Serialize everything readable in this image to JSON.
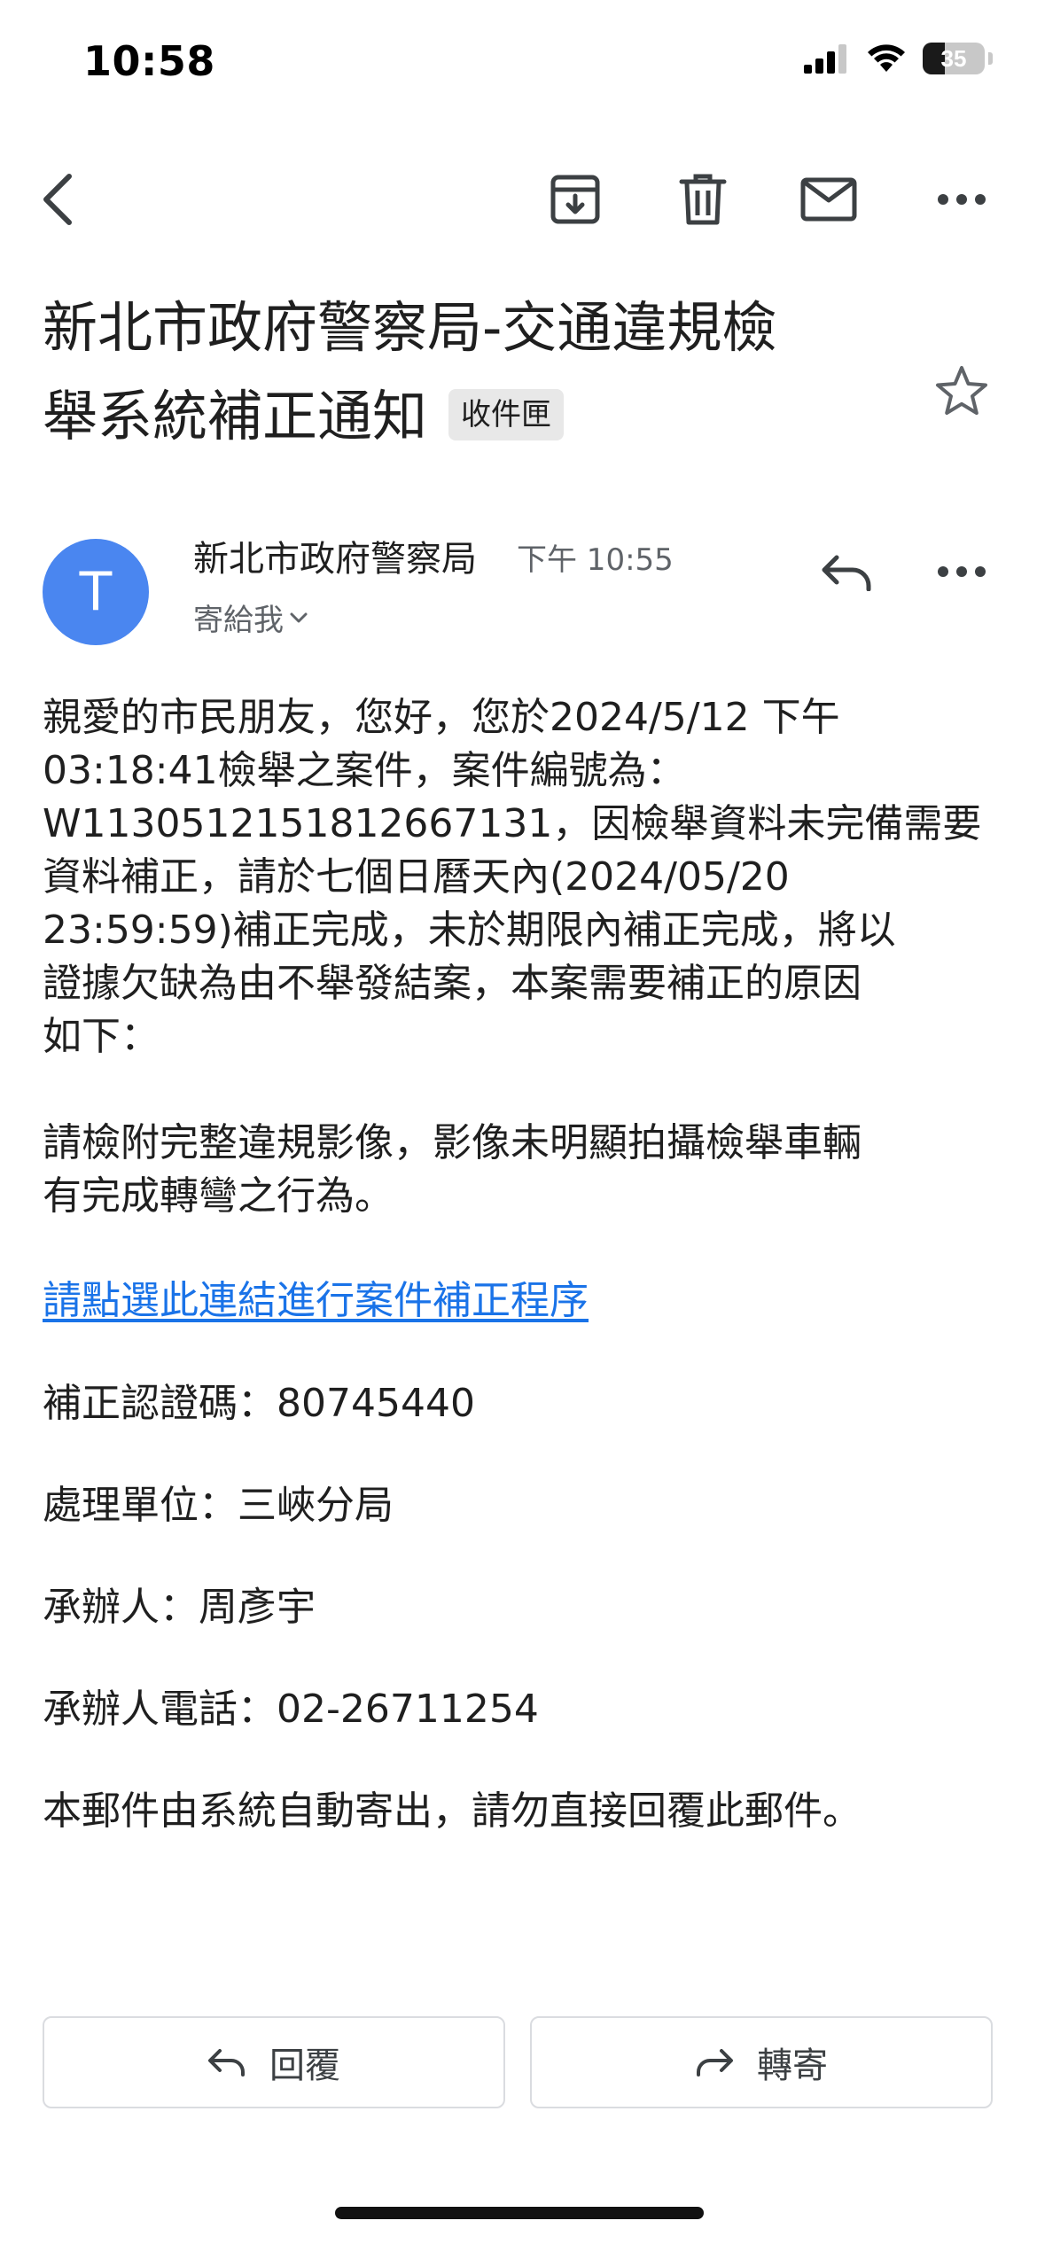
{
  "status_bar": {
    "time": "10:58",
    "battery": "35",
    "battery_level": 0.35
  },
  "toolbar": {
    "icons": [
      "back-arrow-icon",
      "archive-icon",
      "trash-icon",
      "mark-unread-icon",
      "more-icon"
    ]
  },
  "subject": {
    "line1": "新北市政府警察局-交通違規檢",
    "line2": "舉系統補正通知",
    "label": "收件匣"
  },
  "sender": {
    "avatar_letter": "T",
    "avatar_color": "#4a86f0",
    "name": "新北市政府警察局",
    "time": "下午 10:55",
    "recipient": "寄給我"
  },
  "body": {
    "intro_lines": [
      "親愛的市民朋友，您好，您於2024/5/12 下午",
      "03:18:41檢舉之案件，案件編號為：",
      "W1130512151812667131，因檢舉資料未完備需要",
      "資料補正，請於七個日曆天內(2024/05/20",
      "23:59:59)補正完成，未於期限內補正完成，將以",
      "證據欠缺為由不舉發結案，本案需要補正的原因",
      "如下："
    ],
    "reason_lines": [
      "請檢附完整違規影像，影像未明顯拍攝檢舉車輛",
      "有完成轉彎之行為。"
    ],
    "link_text": "請點選此連結進行案件補正程序",
    "link_color": "#1a73e8",
    "verification_code": "補正認證碼：80745440",
    "unit": "處理單位：三峽分局",
    "handler": "承辦人：周彥宇",
    "phone": "承辦人電話：02-26711254",
    "footer": "本郵件由系統自動寄出，請勿直接回覆此郵件。"
  },
  "actions": {
    "reply_label": "回覆",
    "forward_label": "轉寄"
  }
}
